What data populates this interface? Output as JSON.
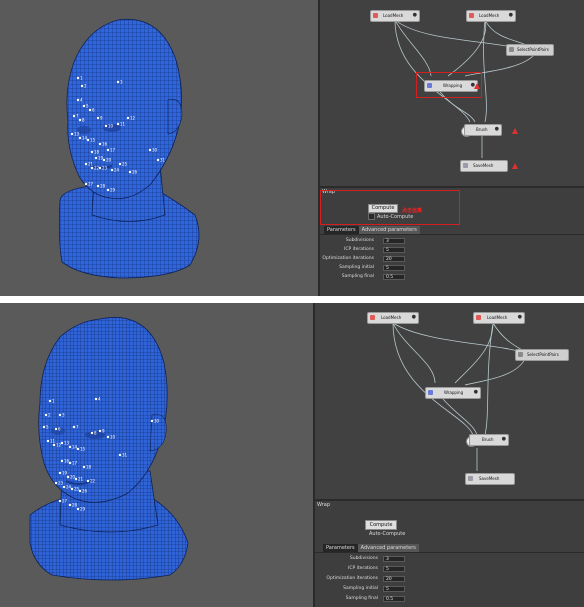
{
  "graph": {
    "nodes": {
      "loadmesh_a": "LoadMesh",
      "loadmesh_b": "LoadMesh",
      "selectpointpairs": "SelectPointPairs",
      "wrapping": "Wrapping",
      "brush": "Brush",
      "savemesh": "SaveMesh"
    }
  },
  "panel": {
    "title": "Wrap",
    "compute_label": "Compute",
    "auto_compute_label": "Auto-Compute",
    "tabs": [
      "Parameters",
      "Advanced parameters"
    ],
    "params": [
      {
        "label": "Subdivisions",
        "value": "3"
      },
      {
        "label": "ICP iterations",
        "value": "5"
      },
      {
        "label": "Optimization iterations",
        "value": "20"
      },
      {
        "label": "Sampling initial",
        "value": "5"
      },
      {
        "label": "Sampling final",
        "value": "0.5"
      }
    ]
  },
  "annotation": {
    "text": "点击运算"
  },
  "landmarks_top": [
    "1",
    "2",
    "3",
    "4",
    "5",
    "6",
    "7",
    "8",
    "9",
    "10",
    "11",
    "12",
    "13",
    "14",
    "15",
    "16",
    "17",
    "18",
    "19",
    "20",
    "21",
    "22",
    "23",
    "24",
    "25",
    "26",
    "27",
    "28",
    "29",
    "30",
    "31"
  ],
  "landmarks_bottom": [
    "1",
    "2",
    "3",
    "4",
    "5",
    "6",
    "7",
    "8",
    "9",
    "10",
    "11",
    "12",
    "13",
    "14",
    "15",
    "16",
    "17",
    "18",
    "19",
    "20",
    "21",
    "22",
    "23",
    "24",
    "25",
    "26",
    "27",
    "28",
    "29",
    "30",
    "31"
  ],
  "colors": {
    "mesh_blue": "#2f64d8",
    "viewport_bg": "#5a5a5a",
    "graph_bg": "#414141",
    "highlight_red": "#d21f1f"
  }
}
